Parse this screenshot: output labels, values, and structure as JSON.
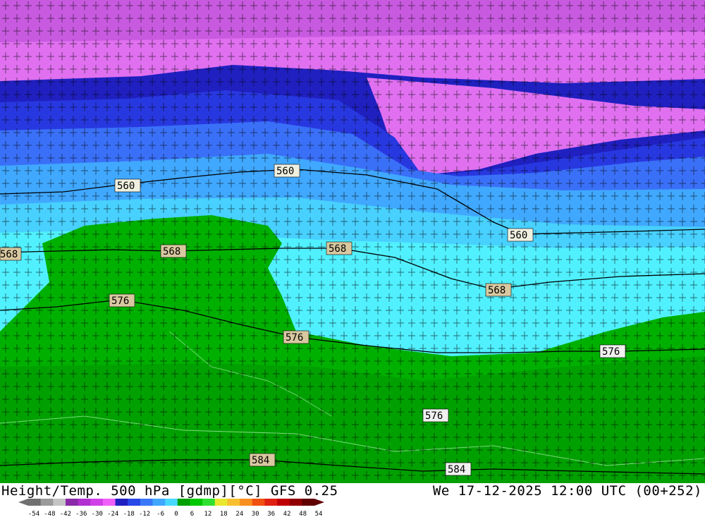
{
  "header": {
    "title": "Height/Temp. 500 hPa [gdmp][°C] GFS 0.25",
    "valid_time": "We 17-12-2025 12:00 UTC (00+252)"
  },
  "map": {
    "contour_labels": [
      {
        "id": "label-560-a",
        "text": "560"
      },
      {
        "id": "label-560-b",
        "text": "560"
      },
      {
        "id": "label-560-c",
        "text": "560"
      },
      {
        "id": "label-568-a",
        "text": "568"
      },
      {
        "id": "label-568-b",
        "text": "568"
      },
      {
        "id": "label-568-c",
        "text": "568"
      },
      {
        "id": "label-568-d",
        "text": "568"
      },
      {
        "id": "label-576-a",
        "text": "576"
      },
      {
        "id": "label-576-b",
        "text": "576"
      },
      {
        "id": "label-576-c",
        "text": "576"
      },
      {
        "id": "label-576-d",
        "text": "576"
      },
      {
        "id": "label-584-a",
        "text": "584"
      },
      {
        "id": "label-584-b",
        "text": "584"
      }
    ]
  },
  "legend": {
    "ticks": [
      "-54",
      "-48",
      "-42",
      "-36",
      "-30",
      "-24",
      "-18",
      "-12",
      "-6",
      "0",
      "6",
      "12",
      "18",
      "24",
      "30",
      "36",
      "42",
      "48",
      "54"
    ],
    "colors": [
      "#707070",
      "#9a9a9a",
      "#c4c4c4",
      "#8a2aa8",
      "#b030d0",
      "#d040e8",
      "#f060f8",
      "#2020c0",
      "#2848e8",
      "#3a78f8",
      "#40a8ff",
      "#48d8ff",
      "#00a000",
      "#00c800",
      "#30e030",
      "#e8e830",
      "#f8c030",
      "#f89020",
      "#f05010",
      "#e02010",
      "#c00000",
      "#900000",
      "#600000"
    ]
  }
}
